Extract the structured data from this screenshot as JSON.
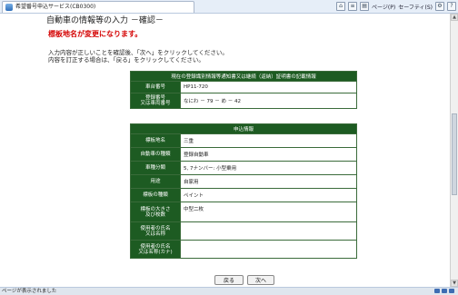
{
  "browser": {
    "tab_title": "希望番号申込サービス(CB0300)",
    "toolbar": {
      "page_label": "ページ(P)",
      "safety_label": "セーフティ(S)"
    }
  },
  "page": {
    "title": "自動車の情報等の入力 －確認－",
    "error_message": "標板地名が変更になります。",
    "instruction_line1": "入力内容が正しいことを確認後、「次へ」をクリックしてください。",
    "instruction_line2": "内容を訂正する場合は、「戻る」をクリックしてください。"
  },
  "certificate_table": {
    "caption": "現在の登録識別情報等通知書又は継続（返納）証明書の記載情報",
    "rows": [
      {
        "label": "車台番号",
        "value": "HP11-720"
      },
      {
        "label": "登録番号\n又は車両番号",
        "value": "なにわ － 79 － め － 42"
      }
    ]
  },
  "application_table": {
    "caption": "申込情報",
    "rows": [
      {
        "label": "標板地名",
        "value": "三重"
      },
      {
        "label": "自動車の種類",
        "value": "登録自動車"
      },
      {
        "label": "車種分類",
        "value": "5, 7ナンバー: 小型乗用"
      },
      {
        "label": "用途",
        "value": "自家用"
      },
      {
        "label": "標板の種類",
        "value": "ペイント"
      },
      {
        "label": "標板の大きさ\n及び枚数",
        "value": "中型二枚"
      },
      {
        "label": "使用者の氏名\n又は名称",
        "value": ""
      },
      {
        "label": "使用者の氏名\n又は名称(カナ)",
        "value": ""
      }
    ]
  },
  "buttons": {
    "back": "戻る",
    "next": "次へ"
  },
  "statusbar": {
    "text": "ページが表示されました"
  }
}
